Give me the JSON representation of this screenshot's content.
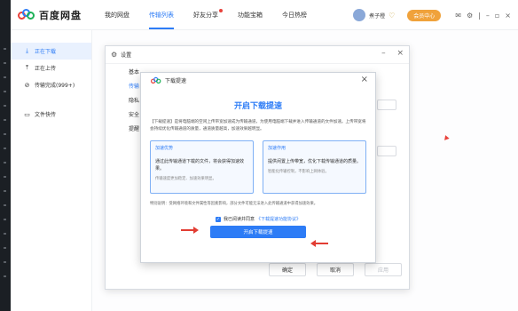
{
  "app": {
    "name": "百度网盘"
  },
  "nav": [
    {
      "label": "我的网盘"
    },
    {
      "label": "传输列表"
    },
    {
      "label": "好友分享"
    },
    {
      "label": "功能宝箱"
    },
    {
      "label": "今日热榜"
    }
  ],
  "topbar": {
    "username": "煮子橙",
    "member_label": "会员中心"
  },
  "sidebar": [
    {
      "label": "正在下载",
      "icon": "download-icon"
    },
    {
      "label": "正在上传",
      "icon": "upload-icon"
    },
    {
      "label": "传输完成(999+)",
      "icon": "check-circle-icon"
    },
    {
      "label": "文件快传",
      "icon": "monitor-icon"
    }
  ],
  "settings": {
    "title": "设置",
    "tabs": [
      {
        "label": "基本"
      },
      {
        "label": "传输"
      },
      {
        "label": "隐私"
      },
      {
        "label": "安全"
      },
      {
        "label": "提醒"
      }
    ],
    "confirm": "确定",
    "cancel": "取消",
    "apply": "应用"
  },
  "accel": {
    "header_title": "下载提速",
    "title": "开启下载提速",
    "description": "【下载提速】是将电脑端的空闲上传带宽加速成为传输通道，为使用电脑端下载并进入传输通道的文件加速。上传带宽将会持续优化传输通道的质量，通道质量越高，加速效果越明显。",
    "cards": [
      {
        "title": "加速优势",
        "text": "通过此传输通道下载的文件，将会获得加速效果。",
        "sub": "传输速度更加稳定、加速效果明显。"
      },
      {
        "title": "加速作用",
        "text": "提供闲置上传带宽，优化下载传输通道的质量。",
        "sub": "智能化传输控制，不影响上网体验。"
      }
    ],
    "note": "特别说明：受网络环境和文件属性等因素影响，部分文件可能无法进入此传输通道中获得加速效果。",
    "agree_text": "我已阅读并同意",
    "agree_link": "《下载提速功能协议》",
    "button": "开启下载提速"
  },
  "colors": {
    "accent": "#2d7cf6",
    "arrow": "#e23d33",
    "member": "#f0a23b"
  }
}
